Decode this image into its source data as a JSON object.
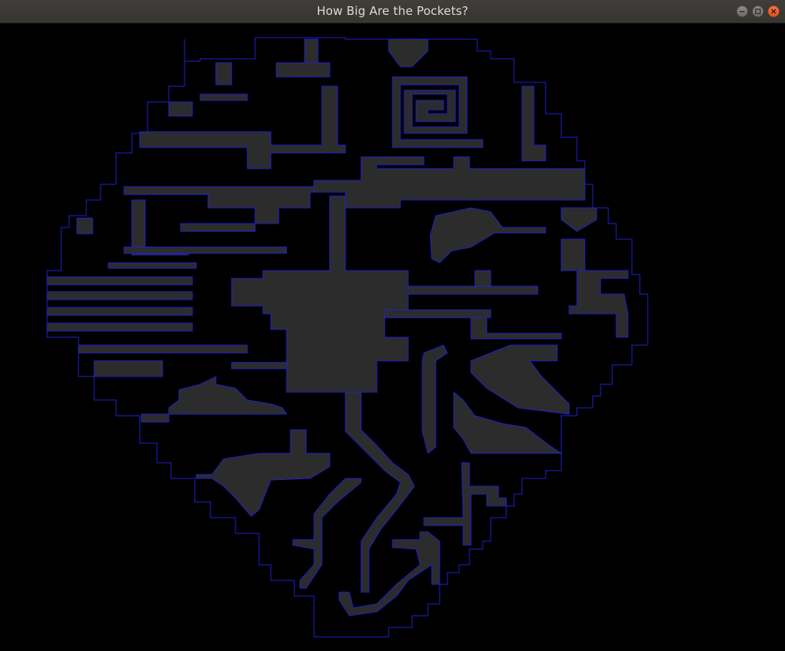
{
  "window": {
    "title": "How Big Are the Pockets?",
    "buttons": [
      {
        "name": "minimize",
        "icon": "minimize-icon"
      },
      {
        "name": "maximize",
        "icon": "maximize-icon"
      },
      {
        "name": "close",
        "icon": "close-icon"
      }
    ]
  },
  "colors": {
    "background": "#000000",
    "outline": "#1f1fcf",
    "pocket_fill": "#2c2c2c",
    "titlebar": "#3c3b37",
    "title_text": "#dfdbd2",
    "close_accent": "#e95420"
  }
}
